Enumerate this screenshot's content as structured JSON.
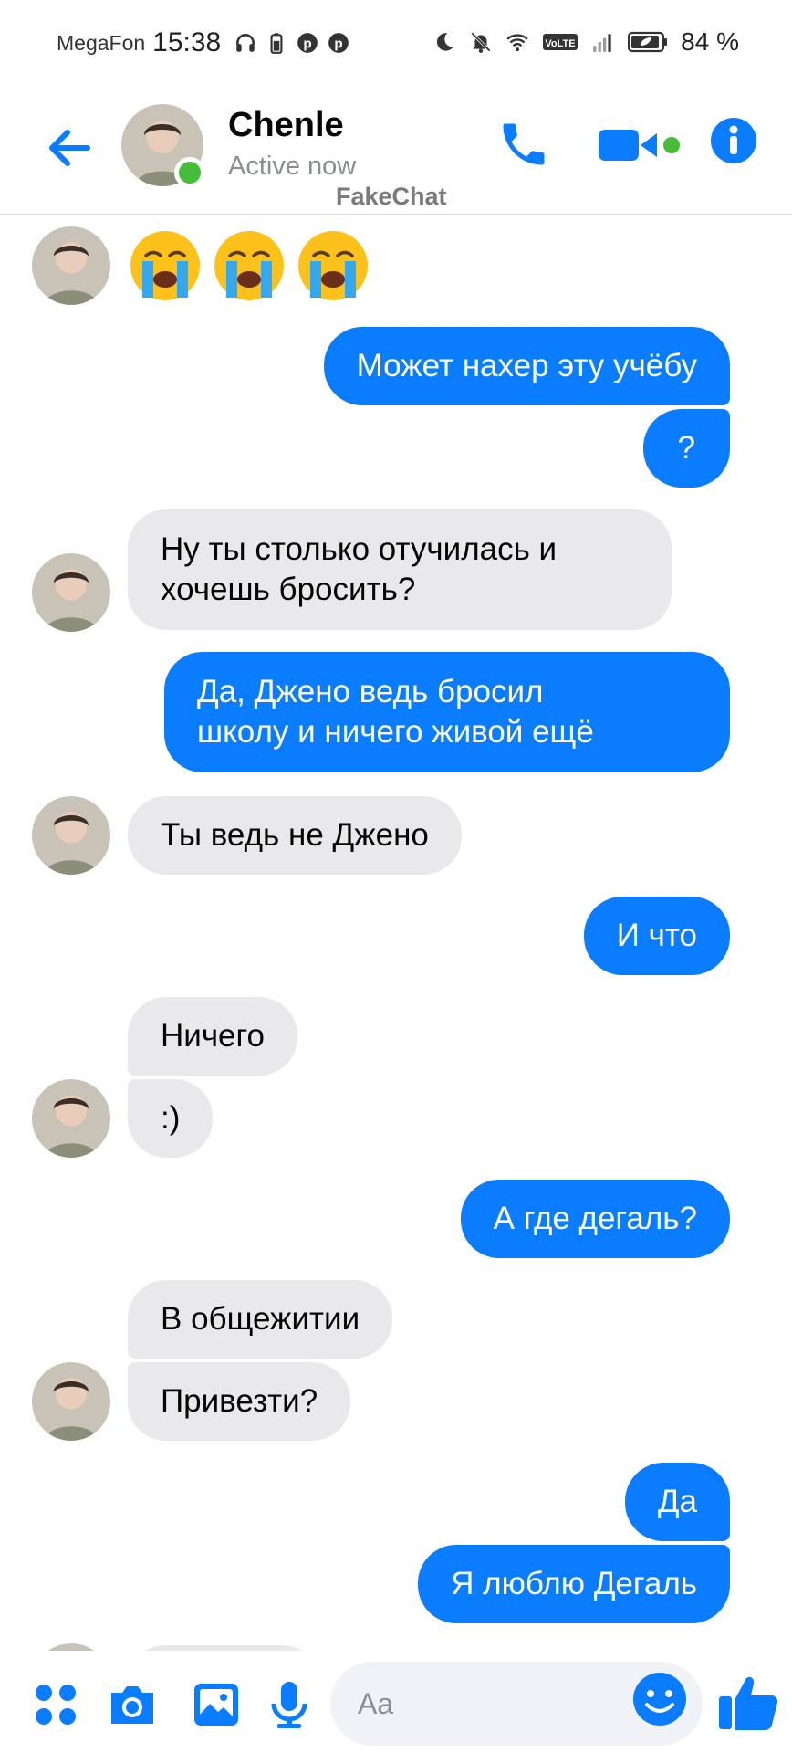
{
  "status_bar": {
    "carrier": "MegaFon",
    "time": "15:38",
    "battery_percent": "84 %",
    "left_icons": [
      "headphones-icon",
      "battery-saver-icon",
      "pinterest-icon",
      "pinterest-icon"
    ],
    "right_icons": [
      "moon-icon",
      "bell-off-icon",
      "wifi-icon",
      "volte-icon",
      "signal-icon",
      "battery-icon"
    ]
  },
  "header": {
    "contact_name": "Chenle",
    "status": "Active now",
    "watermark": "FakeChat",
    "accent_color": "#0a7cff",
    "online_color": "#45bd3a"
  },
  "messages": [
    {
      "side": "in",
      "type": "emoji",
      "emojis": [
        "loudly-crying-face",
        "loudly-crying-face",
        "loudly-crying-face"
      ],
      "avatar": true
    },
    {
      "side": "out",
      "text": "Может нахер эту учёбу"
    },
    {
      "side": "out",
      "text": "?"
    },
    {
      "side": "in",
      "lines": [
        "Ну ты столько отучилась и",
        "хочешь бросить?"
      ],
      "avatar": true
    },
    {
      "side": "out",
      "lines": [
        "Да, Джено ведь бросил",
        "школу и ничего живой ещё"
      ]
    },
    {
      "side": "in",
      "text": "Ты ведь не Джено",
      "avatar": true
    },
    {
      "side": "out",
      "text": "И что"
    },
    {
      "side": "in",
      "text": "Ничего"
    },
    {
      "side": "in",
      "text": ":)",
      "avatar": true
    },
    {
      "side": "out",
      "text": "А где дегаль?"
    },
    {
      "side": "in",
      "text": "В общежитии"
    },
    {
      "side": "in",
      "text": "Привезти?",
      "avatar": true
    },
    {
      "side": "out",
      "text": "Да"
    },
    {
      "side": "out",
      "text": "Я люблю Дегаль"
    }
  ],
  "composer": {
    "placeholder": "Aa",
    "icons": [
      "menu-dots-icon",
      "camera-icon",
      "gallery-icon",
      "microphone-icon",
      "emoji-icon",
      "thumbs-up-icon"
    ]
  }
}
